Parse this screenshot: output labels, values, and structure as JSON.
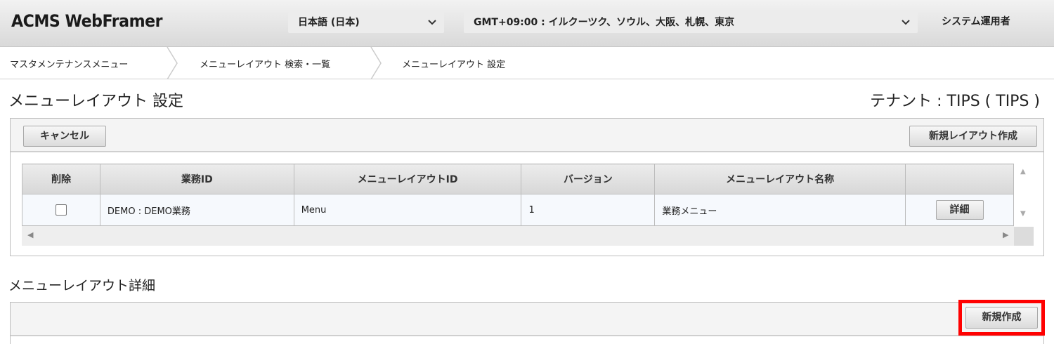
{
  "header": {
    "logo_text": "ACMS WebFramer",
    "language_select": "日本語 (日本)",
    "timezone_select": "GMT+09:00 : イルクーツク、ソウル、大阪、札幌、東京",
    "user_label": "システム運用者"
  },
  "breadcrumb": [
    "マスタメンテナンスメニュー",
    "メニューレイアウト 検索・一覧",
    "メニューレイアウト 設定"
  ],
  "page": {
    "title": "メニューレイアウト 設定",
    "tenant": "テナント : TIPS ( TIPS )"
  },
  "toolbar": {
    "cancel_label": "キャンセル",
    "new_layout_label": "新規レイアウト作成"
  },
  "table": {
    "columns": [
      "削除",
      "業務ID",
      "メニューレイアウトID",
      "バージョン",
      "メニューレイアウト名称",
      ""
    ],
    "rows": [
      {
        "delete_checked": false,
        "business_id": "DEMO : DEMO業務",
        "layout_id": "Menu",
        "version": "1",
        "layout_name": "業務メニュー",
        "detail_label": "詳細"
      }
    ]
  },
  "detail_section": {
    "title": "メニューレイアウト詳細",
    "new_label": "新規作成"
  },
  "colors": {
    "highlight": "#ff0000",
    "header_bg": "#e4e4e4"
  }
}
